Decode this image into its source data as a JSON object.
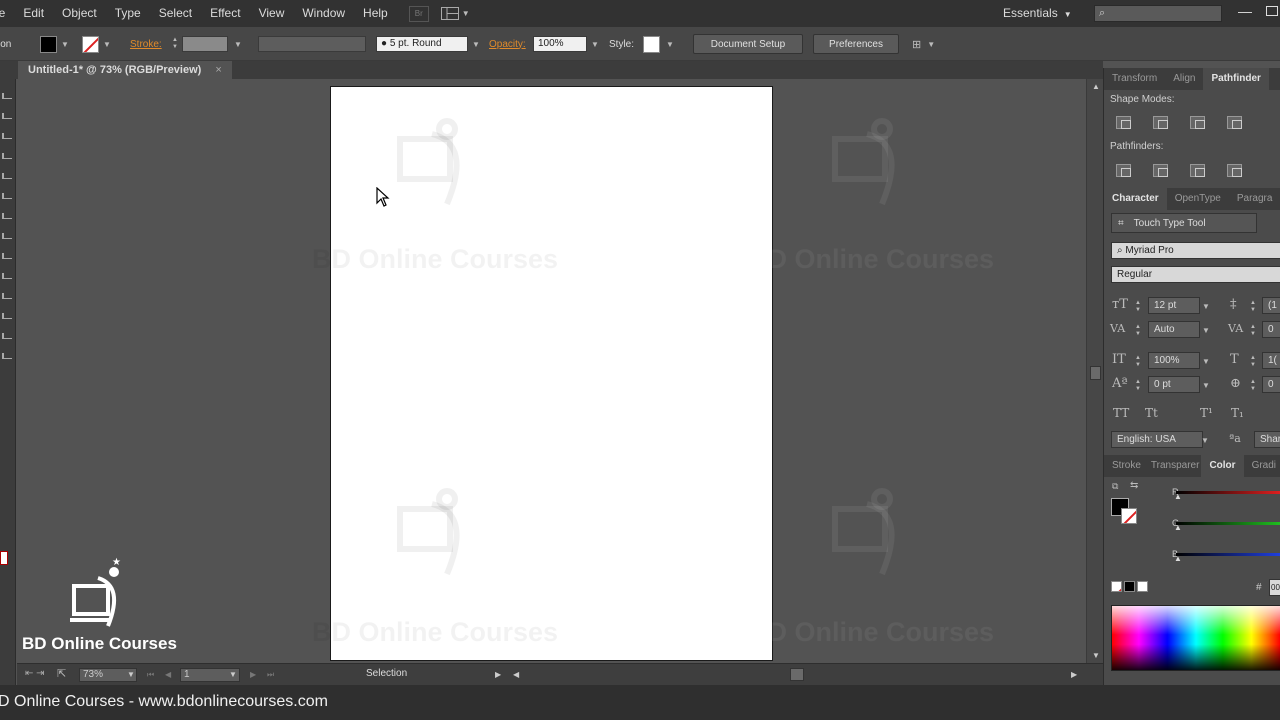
{
  "menu": {
    "items": [
      "le",
      "Edit",
      "Object",
      "Type",
      "Select",
      "Effect",
      "View",
      "Window",
      "Help"
    ],
    "bridge_label": "Br",
    "workspace": "Essentials"
  },
  "control_bar": {
    "left_label": "ion",
    "stroke_label": "Stroke:",
    "brush": "5 pt. Round",
    "opacity_label": "Opacity:",
    "opacity_value": "100%",
    "style_label": "Style:",
    "document_setup": "Document Setup",
    "preferences": "Preferences"
  },
  "document": {
    "tab_title": "Untitled-1* @ 73% (RGB/Preview)",
    "close_glyph": "×"
  },
  "watermark": {
    "text": "BD Online Courses"
  },
  "status_bar": {
    "zoom": "73%",
    "page": "1",
    "mode": "Selection"
  },
  "panels": {
    "top_tabs": [
      "Transform",
      "Align",
      "Pathfinder"
    ],
    "shape_modes_label": "Shape Modes:",
    "pathfinders_label": "Pathfinders:",
    "char_tabs": [
      "Character",
      "OpenType",
      "Paragra"
    ],
    "touch_type": "Touch Type Tool",
    "font_family": "Myriad Pro",
    "font_style": "Regular",
    "font_size": "12 pt",
    "leading_partial": "(1",
    "kerning": "Auto",
    "tracking_partial": "0",
    "vscale": "100%",
    "hscale_partial": "1(",
    "baseline": "0 pt",
    "rotation_partial": "0",
    "caps_glyphs": [
      "TT",
      "Tt",
      "T¹",
      "T₁"
    ],
    "language": "English: USA",
    "aa_glyph": "ªa",
    "sharp_partial": "Shar",
    "bottom_tabs": [
      "Stroke",
      "Transparer",
      "Color",
      "Gradi"
    ],
    "rgb": [
      "R",
      "G",
      "B"
    ],
    "hash": "#",
    "hash_value": "00"
  },
  "brand": {
    "name": "BD Online Courses"
  },
  "footer": {
    "text": "D Online Courses - www.bdonlinecourses.com"
  },
  "colors": {
    "ui_bg": "#535353",
    "accent_orange": "#e08a2a",
    "slider_r": "#e02020",
    "slider_g": "#20c020",
    "slider_b": "#2040e0"
  }
}
